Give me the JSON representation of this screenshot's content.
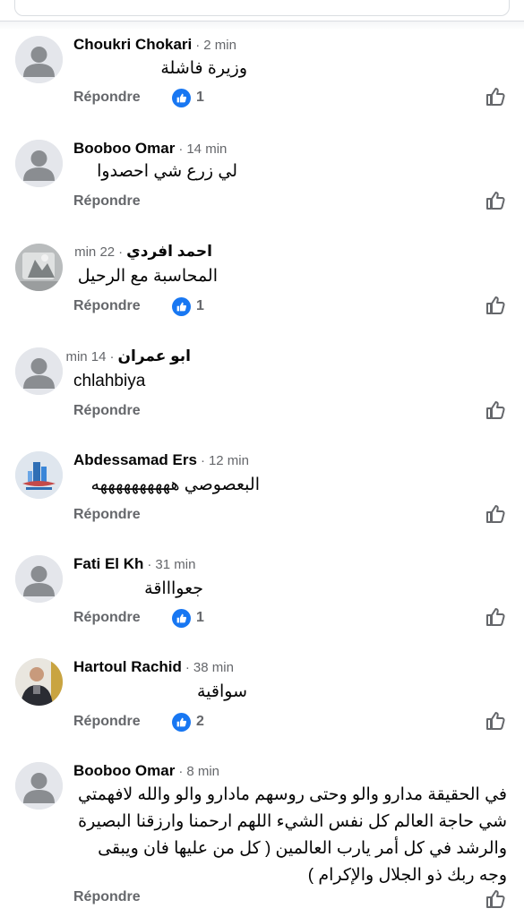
{
  "colors": {
    "accent": "#1877f2",
    "muted": "#65676b",
    "text": "#050505"
  },
  "ui": {
    "reply_label": "Répondre",
    "separator": "·"
  },
  "comments": [
    {
      "author": "Choukri Chokari",
      "time": "2 min",
      "text": "وزيرة فاشلة",
      "reactions": "1",
      "avatar": "default-avatar"
    },
    {
      "author": "Booboo Omar",
      "time": "14 min",
      "text": "لي زرع شي احصدوا",
      "reactions": "",
      "avatar": "default-avatar"
    },
    {
      "author": "احمد افردي",
      "time": "22 min",
      "text": "المحاسبة مع الرحيل",
      "reactions": "1",
      "avatar": "photo-avatar"
    },
    {
      "author": "ابو عمران",
      "time": "14 min",
      "text": "chlahbiya",
      "reactions": "",
      "avatar": "default-avatar"
    },
    {
      "author": "Abdessamad Ers",
      "time": "12 min",
      "text": "البعصوصي ههههههههههه",
      "reactions": "",
      "avatar": "logo-avatar"
    },
    {
      "author": "Fati El Kh",
      "time": "31 min",
      "text": "جعواااقة",
      "reactions": "1",
      "avatar": "default-avatar"
    },
    {
      "author": "Hartoul Rachid",
      "time": "38 min",
      "text": "سواقية",
      "reactions": "2",
      "avatar": "photo-avatar"
    },
    {
      "author": "Booboo Omar",
      "time": "8 min",
      "text": "في الحقيقة مدارو والو  وحتى  روسهم مادارو والو  والله لافهمتي شي حاجة  العالم كل نفس الشيء  اللهم ارحمنا وارزقنا البصيرة والرشد في كل أمر يارب العالمين  ( كل من عليها فان ويبقى وجه  ربك ذو الجلال والإكرام )",
      "reactions": "",
      "avatar": "default-avatar"
    }
  ]
}
